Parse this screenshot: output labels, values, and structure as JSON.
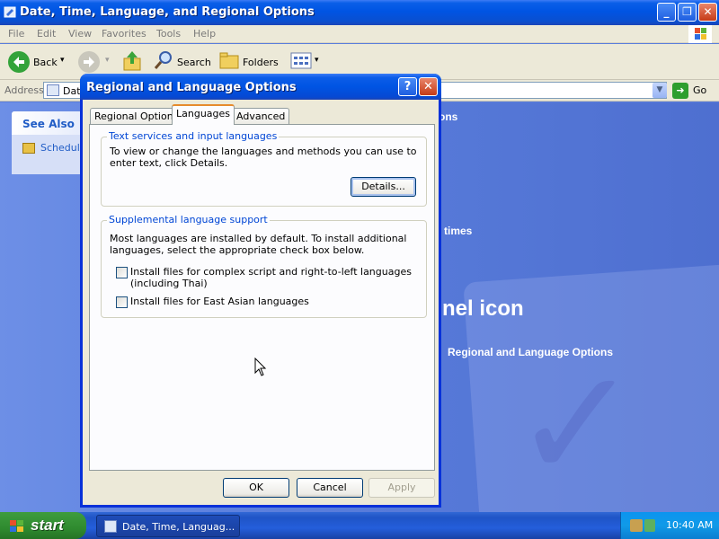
{
  "main_window": {
    "title": "Date, Time, Language, and Regional Options",
    "menu": [
      "File",
      "Edit",
      "View",
      "Favorites",
      "Tools",
      "Help"
    ],
    "toolbar": {
      "back_label": "Back",
      "search_label": "Search",
      "folders_label": "Folders"
    },
    "address": {
      "label": "Address",
      "value": "Dat",
      "go_label": "Go"
    },
    "see_also": {
      "heading": "See Also",
      "item": "Schedule"
    },
    "background_fragments": {
      "ons": "ons",
      "times": "times",
      "icon_heading": "nel icon",
      "link": "Regional and Language Options"
    }
  },
  "dialog": {
    "title": "Regional and Language Options",
    "tabs": [
      {
        "label": "Regional Options",
        "active": false
      },
      {
        "label": "Languages",
        "active": true
      },
      {
        "label": "Advanced",
        "active": false
      }
    ],
    "text_services": {
      "heading": "Text services and input languages",
      "description": "To view or change the languages and methods you can use to enter text, click Details.",
      "details_button": "Details..."
    },
    "supplemental": {
      "heading": "Supplemental language support",
      "description": "Most languages are installed by default. To install additional languages, select the appropriate check box below.",
      "complex_script_label": "Install files for complex script and right-to-left languages (including Thai)",
      "complex_script_checked": false,
      "east_asian_label": "Install files for East Asian languages",
      "east_asian_checked": false
    },
    "buttons": {
      "ok": "OK",
      "cancel": "Cancel",
      "apply": "Apply"
    }
  },
  "taskbar": {
    "start_label": "start",
    "task_button": "Date, Time, Languag...",
    "clock": "10:40 AM"
  }
}
